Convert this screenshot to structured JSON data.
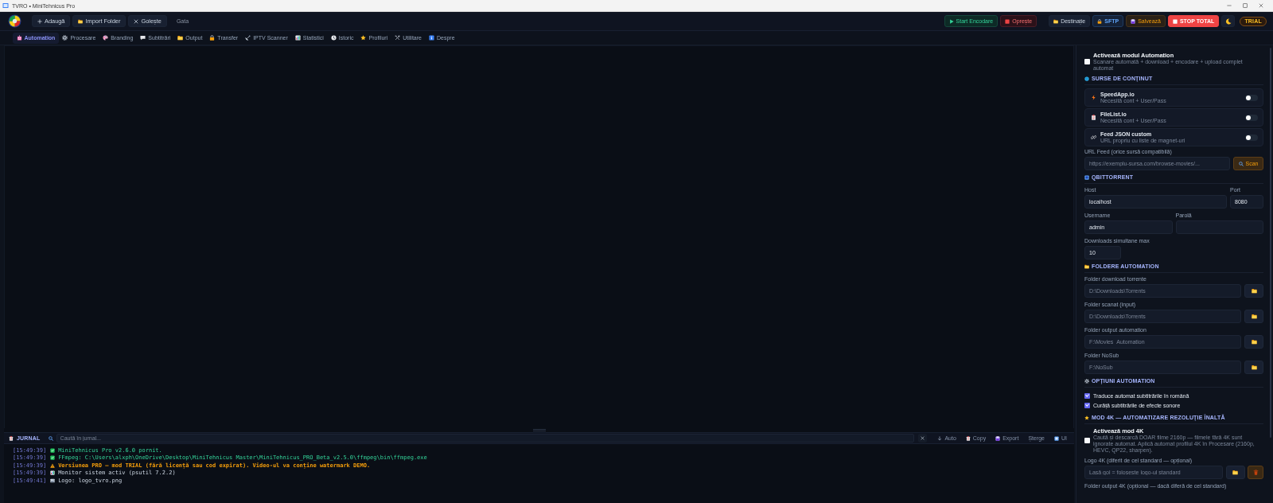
{
  "window": {
    "title": "TVRO • MiniTehnicus Pro"
  },
  "header": {
    "left_buttons": [
      {
        "label": "Adaugă"
      },
      {
        "label": "Import Folder"
      },
      {
        "label": "Golește"
      }
    ],
    "status": "Gata",
    "encode_buttons": [
      {
        "label": "Start Encodare",
        "kind": "success"
      },
      {
        "label": "Oprește",
        "kind": "danger"
      }
    ],
    "action_buttons": [
      {
        "label": "Destinație",
        "kind": "neutral"
      },
      {
        "label": "SFTP",
        "kind": "info"
      },
      {
        "label": "Salvează",
        "kind": "warning"
      },
      {
        "label": "STOP TOTAL",
        "kind": "stop"
      }
    ],
    "badge": "TRIAL"
  },
  "tabs": [
    {
      "label": "Automation",
      "selected": true
    },
    {
      "label": "Procesare",
      "selected": false
    },
    {
      "label": "Branding",
      "selected": false
    },
    {
      "label": "Subtitrări",
      "selected": false
    },
    {
      "label": "Output",
      "selected": false
    },
    {
      "label": "Transfer",
      "selected": false
    },
    {
      "label": "IPTV Scanner",
      "selected": false
    },
    {
      "label": "Statistici",
      "selected": false
    },
    {
      "label": "Istoric",
      "selected": false
    },
    {
      "label": "Profiluri",
      "selected": false
    },
    {
      "label": "Utilitare",
      "selected": false
    },
    {
      "label": "Despre",
      "selected": false
    }
  ],
  "journal": {
    "title": "JURNAL",
    "search": {
      "placeholder": "Caută în jurnal..."
    },
    "buttons": [
      {
        "label": "Auto"
      },
      {
        "label": "Copy"
      },
      {
        "label": "Export"
      },
      {
        "label": "Șterge"
      },
      {
        "label": "UI"
      }
    ],
    "entries": [
      {
        "time": "[15:49:39]",
        "kind": "success",
        "text": "MiniTehnicus Pro v2.6.0 pornit."
      },
      {
        "time": "[15:49:39]",
        "kind": "success",
        "text": "FFmpeg: C:\\Users\\alxph\\OneDrive\\Desktop\\MiniTehnicus Master\\MiniTehnicus_PRO_Beta_v2.5.0\\ffmpeg\\bin\\ffmpeg.exe"
      },
      {
        "time": "[15:49:39]",
        "kind": "warning",
        "text": "Versiunea PRO — mod TRIAL (fără licență sau cod expirat). Video-ul va conține watermark DEMO."
      },
      {
        "time": "[15:49:39]",
        "kind": "stats",
        "text": "Monitor sistem activ (psutil 7.2.2)"
      },
      {
        "time": "[15:49:41]",
        "kind": "media",
        "text": "Logo: logo_tvro.png"
      }
    ]
  },
  "automation_panel": {
    "enable": {
      "label": "Activează modul Automation",
      "description": "Scanare automată + download + encodare + upload complet automat",
      "checked": false
    },
    "sources": {
      "title": "SURSE DE CONȚINUT",
      "items": [
        {
          "name": "SpeedApp.io",
          "description": "Necesită cont + User/Pass",
          "on": false
        },
        {
          "name": "FileList.io",
          "description": "Necesită cont + User/Pass",
          "on": false
        },
        {
          "name": "Feed JSON custom",
          "description": "URL propriu cu liste de magnet-uri",
          "on": false
        }
      ]
    },
    "url_feed": {
      "label": "URL Feed (orice sursă compatibilă)",
      "placeholder": "https://exemplu-sursa.com/browse-movies/...",
      "button": "Scan"
    },
    "qbittorrent": {
      "title": "QBITTORRENT",
      "host": {
        "label": "Host",
        "value": "localhost"
      },
      "port": {
        "label": "Port",
        "value": "8080"
      },
      "username": {
        "label": "Username",
        "value": "admin"
      },
      "password": {
        "label": "Parolă"
      },
      "max_downloads": {
        "label": "Downloads simultane max",
        "value": "10"
      }
    },
    "folders": {
      "title": "FOLDERE AUTOMATION",
      "items": [
        {
          "label": "Folder download torrente",
          "placeholder": "D:\\Downloads\\Torrents"
        },
        {
          "label": "Folder scanat (input)",
          "placeholder": "D:\\Downloads\\Torrents"
        },
        {
          "label": "Folder output automation",
          "placeholder": "F:\\Movies_Automation"
        },
        {
          "label": "Folder NoSub",
          "placeholder": "F:\\NoSub"
        }
      ]
    },
    "options": {
      "title": "OPȚIUNI AUTOMATION",
      "items": [
        {
          "label": "Traduce automat subtitrările în română",
          "checked": true
        },
        {
          "label": "Curăță subtitrările de efecte sonore",
          "checked": true
        }
      ]
    },
    "mode_4k": {
      "title": "MOD 4K — AUTOMATIZARE REZOLUȚIE ÎNALTĂ",
      "enable": {
        "label": "Activează mod 4K",
        "description": "Caută și descarcă DOAR filme 2160p — filmele fără 4K sunt ignorate automat. Aplică automat profilul 4K în Procesare (2160p, HEVC, QP22, sharpen).",
        "checked": false
      },
      "logo": {
        "label": "Logo 4K (diferit de cel standard — opțional)",
        "placeholder": "Lasă gol = folosește logo-ul standard"
      },
      "output_folder": {
        "label": "Folder output 4K (opțional — dacă diferă de cel standard)"
      }
    }
  }
}
